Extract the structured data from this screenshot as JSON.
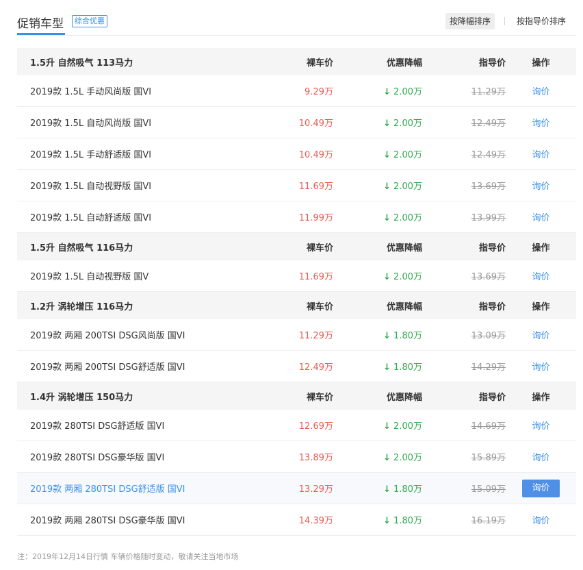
{
  "header": {
    "title": "促销车型",
    "tag": "综合优惠",
    "sort_by_discount": "按降幅排序",
    "sort_by_guide": "按指导价排序"
  },
  "columns": {
    "price": "裸车价",
    "discount": "优惠降幅",
    "guide": "指导价",
    "op": "操作"
  },
  "groups": [
    {
      "name": "1.5升 自然吸气 113马力",
      "rows": [
        {
          "name": "2019款 1.5L 手动风尚版 国VI",
          "price": "9.29万",
          "discount": "2.00万",
          "guide": "11.29万",
          "op": "询价"
        },
        {
          "name": "2019款 1.5L 自动风尚版 国VI",
          "price": "10.49万",
          "discount": "2.00万",
          "guide": "12.49万",
          "op": "询价"
        },
        {
          "name": "2019款 1.5L 手动舒适版 国VI",
          "price": "10.49万",
          "discount": "2.00万",
          "guide": "12.49万",
          "op": "询价"
        },
        {
          "name": "2019款 1.5L 自动视野版 国VI",
          "price": "11.69万",
          "discount": "2.00万",
          "guide": "13.69万",
          "op": "询价"
        },
        {
          "name": "2019款 1.5L 自动舒适版 国VI",
          "price": "11.99万",
          "discount": "2.00万",
          "guide": "13.99万",
          "op": "询价"
        }
      ]
    },
    {
      "name": "1.5升 自然吸气 116马力",
      "rows": [
        {
          "name": "2019款 1.5L 自动视野版 国V",
          "price": "11.69万",
          "discount": "2.00万",
          "guide": "13.69万",
          "op": "询价"
        }
      ]
    },
    {
      "name": "1.2升 涡轮增压 116马力",
      "rows": [
        {
          "name": "2019款 两厢 200TSI DSG风尚版 国VI",
          "price": "11.29万",
          "discount": "1.80万",
          "guide": "13.09万",
          "op": "询价"
        },
        {
          "name": "2019款 两厢 200TSI DSG舒适版 国VI",
          "price": "12.49万",
          "discount": "1.80万",
          "guide": "14.29万",
          "op": "询价"
        }
      ]
    },
    {
      "name": "1.4升 涡轮增压 150马力",
      "rows": [
        {
          "name": "2019款 280TSI DSG舒适版 国VI",
          "price": "12.69万",
          "discount": "2.00万",
          "guide": "14.69万",
          "op": "询价"
        },
        {
          "name": "2019款 280TSI DSG豪华版 国VI",
          "price": "13.89万",
          "discount": "2.00万",
          "guide": "15.89万",
          "op": "询价"
        },
        {
          "name": "2019款 两厢 280TSI DSG舒适版 国VI",
          "price": "13.29万",
          "discount": "1.80万",
          "guide": "15.09万",
          "op": "询价",
          "highlighted": true
        },
        {
          "name": "2019款 两厢 280TSI DSG豪华版 国VI",
          "price": "14.39万",
          "discount": "1.80万",
          "guide": "16.19万",
          "op": "询价"
        }
      ]
    }
  ],
  "note": "注：2019年12月14日行情 车辆价格随时变动，敬请关注当地市场",
  "colors": {
    "accent": "#3a8fe8",
    "price": "#e85a4f",
    "discount": "#2fa84f",
    "muted": "#999999"
  },
  "icons": {
    "down_arrow": "↓"
  }
}
